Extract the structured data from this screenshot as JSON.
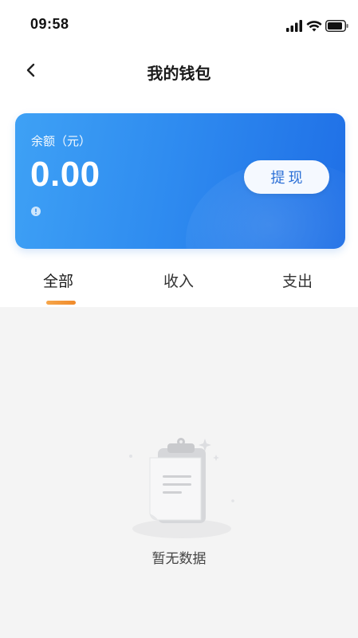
{
  "status_bar": {
    "time": "09:58",
    "icons": [
      "signal-icon",
      "wifi-icon",
      "battery-icon"
    ]
  },
  "nav": {
    "back_icon": "chevron-left-icon",
    "title": "我的钱包"
  },
  "wallet_card": {
    "balance_label": "余额（元）",
    "balance_amount": "0.00",
    "withdraw_label": "提现",
    "info_icon": "info-icon",
    "colors": {
      "gradient_start": "#3ea1f5",
      "gradient_end": "#1f6fe6",
      "button_text": "#2b6fd6"
    }
  },
  "tabs": {
    "all": "全部",
    "income": "收入",
    "expense": "支出",
    "active": "all",
    "indicator_color": "#f08a2a"
  },
  "empty_state": {
    "icon": "clipboard-icon",
    "text": "暂无数据"
  }
}
